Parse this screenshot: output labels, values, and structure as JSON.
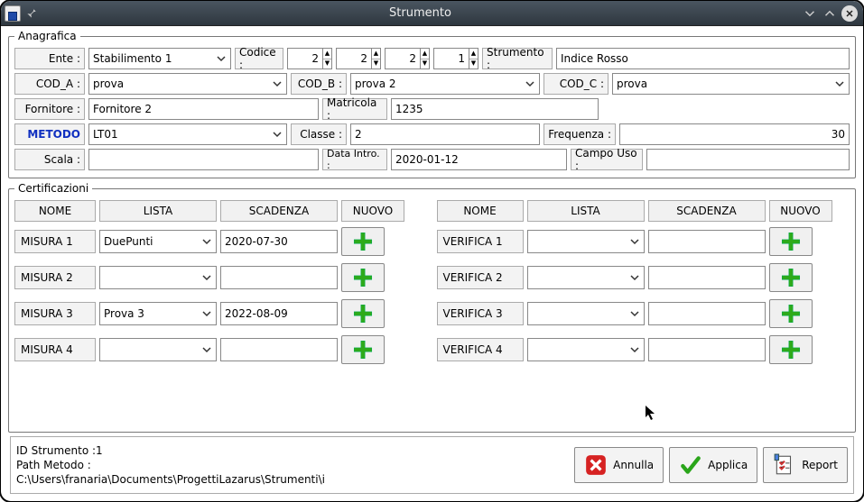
{
  "window": {
    "title": "Strumento"
  },
  "anagrafica": {
    "legend": "Anagrafica",
    "ente_label": "Ente :",
    "ente_value": "Stabilimento 1",
    "codice_label": "Codice :",
    "codice_values": [
      "2",
      "2",
      "2",
      "1"
    ],
    "strumento_label": "Strumento :",
    "strumento_value": "Indice Rosso",
    "coda_label": "COD_A :",
    "coda_value": "prova",
    "codb_label": "COD_B :",
    "codb_value": "prova 2",
    "codc_label": "COD_C :",
    "codc_value": "prova",
    "fornitore_label": "Fornitore :",
    "fornitore_value": "Fornitore 2",
    "matricola_label": "Matricola :",
    "matricola_value": "1235",
    "metodo_label": "METODO",
    "metodo_value": "LT01",
    "classe_label": "Classe :",
    "classe_value": "2",
    "frequenza_label": "Frequenza :",
    "frequenza_value": "30",
    "scala_label": "Scala :",
    "scala_value": "",
    "dataintro_label": "Data Intro. :",
    "dataintro_value": "2020-01-12",
    "campouso_label": "Campo Uso :",
    "campouso_value": ""
  },
  "certificazioni": {
    "legend": "Certificazioni",
    "headers": {
      "nome": "NOME",
      "lista": "LISTA",
      "scadenza": "SCADENZA",
      "nuovo": "NUOVO"
    },
    "misura": [
      {
        "name": "MISURA 1",
        "lista": "DuePunti",
        "scadenza": "2020-07-30"
      },
      {
        "name": "MISURA 2",
        "lista": "",
        "scadenza": ""
      },
      {
        "name": "MISURA 3",
        "lista": "Prova 3",
        "scadenza": "2022-08-09"
      },
      {
        "name": "MISURA 4",
        "lista": "",
        "scadenza": ""
      }
    ],
    "verifica": [
      {
        "name": "VERIFICA 1",
        "lista": "",
        "scadenza": ""
      },
      {
        "name": "VERIFICA 2",
        "lista": "",
        "scadenza": ""
      },
      {
        "name": "VERIFICA 3",
        "lista": "",
        "scadenza": ""
      },
      {
        "name": "VERIFICA 4",
        "lista": "",
        "scadenza": ""
      }
    ]
  },
  "footer": {
    "id_line": "ID Strumento :1",
    "path_label": "Path Metodo :",
    "path_value": "C:\\Users\\franaria\\Documents\\ProgettiLazarus\\Strumenti\\i",
    "annulla": "Annulla",
    "applica": "Applica",
    "report": "Report"
  }
}
